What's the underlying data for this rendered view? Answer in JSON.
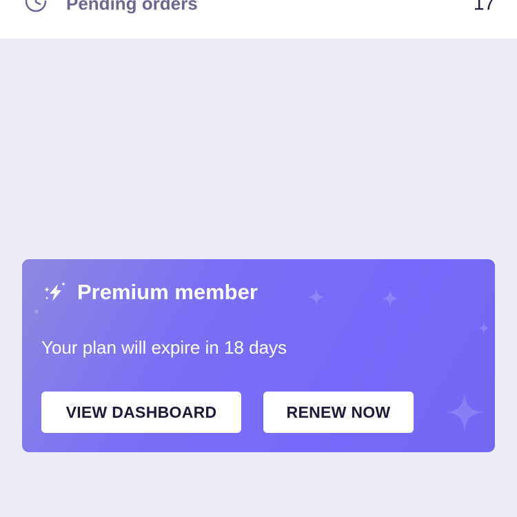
{
  "pending": {
    "label": "Pending orders",
    "value": "17",
    "icon": "clock-pending-icon"
  },
  "premium_card": {
    "title": "Premium member",
    "subtitle": "Your plan will expire in 18 days",
    "icon": "lightning-sparkle-icon",
    "dashboard_button": "VIEW DASHBOARD",
    "renew_button": "RENEW NOW",
    "colors": {
      "card_start": "#8e88e0",
      "card_end": "#7268f3",
      "button_bg": "#ffffff",
      "button_text": "#1c1a3b"
    }
  },
  "colors": {
    "page_background": "#eeedf7",
    "row_background": "#ffffff",
    "row_label": "#6b6894",
    "row_value": "#1c1a3b"
  }
}
